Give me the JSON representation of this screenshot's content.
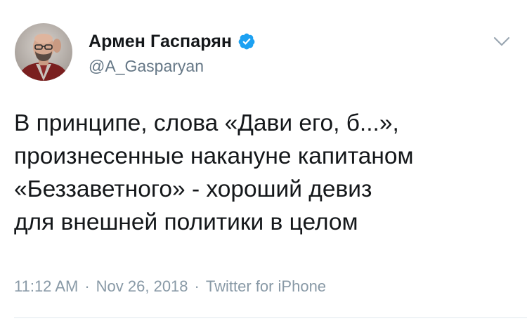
{
  "tweet": {
    "author": {
      "name": "Армен Гаспарян",
      "handle": "@A_Gasparyan",
      "verified": true,
      "avatar_icon": "profile-photo"
    },
    "text_lines": [
      "В принципе, слова «Дави его, б...»,",
      "произнесенные накануне капитаном",
      "«Беззаветного» - хороший девиз",
      "для внешней политики в целом"
    ],
    "meta": {
      "time": "11:12 AM",
      "separator": "·",
      "date": "Nov 26, 2018",
      "source": "Twitter for iPhone"
    },
    "menu_icon": "chevron-down-icon"
  },
  "colors": {
    "primary_text": "#14171a",
    "secondary_text": "#657786",
    "meta_text": "#8899a6",
    "verified_blue": "#1da1f2",
    "divider": "#e1e8ed"
  }
}
